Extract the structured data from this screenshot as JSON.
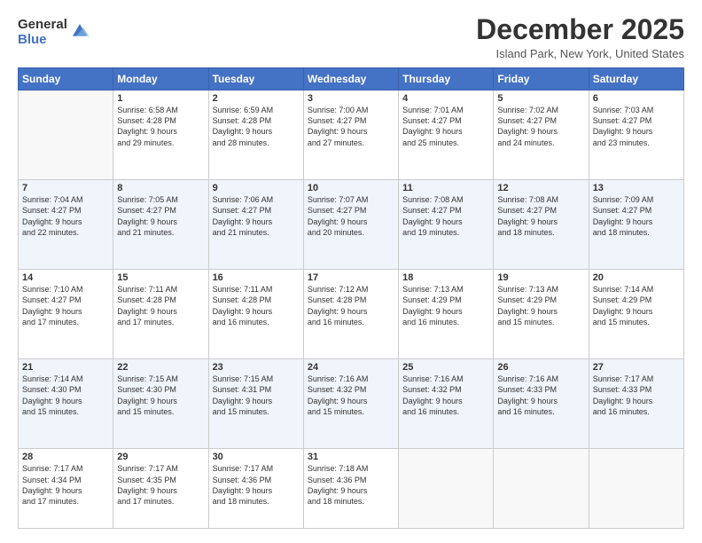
{
  "logo": {
    "general": "General",
    "blue": "Blue"
  },
  "header": {
    "month": "December 2025",
    "location": "Island Park, New York, United States"
  },
  "days_of_week": [
    "Sunday",
    "Monday",
    "Tuesday",
    "Wednesday",
    "Thursday",
    "Friday",
    "Saturday"
  ],
  "weeks": [
    [
      {
        "day": "",
        "info": ""
      },
      {
        "day": "1",
        "info": "Sunrise: 6:58 AM\nSunset: 4:28 PM\nDaylight: 9 hours\nand 29 minutes."
      },
      {
        "day": "2",
        "info": "Sunrise: 6:59 AM\nSunset: 4:28 PM\nDaylight: 9 hours\nand 28 minutes."
      },
      {
        "day": "3",
        "info": "Sunrise: 7:00 AM\nSunset: 4:27 PM\nDaylight: 9 hours\nand 27 minutes."
      },
      {
        "day": "4",
        "info": "Sunrise: 7:01 AM\nSunset: 4:27 PM\nDaylight: 9 hours\nand 25 minutes."
      },
      {
        "day": "5",
        "info": "Sunrise: 7:02 AM\nSunset: 4:27 PM\nDaylight: 9 hours\nand 24 minutes."
      },
      {
        "day": "6",
        "info": "Sunrise: 7:03 AM\nSunset: 4:27 PM\nDaylight: 9 hours\nand 23 minutes."
      }
    ],
    [
      {
        "day": "7",
        "info": "Sunrise: 7:04 AM\nSunset: 4:27 PM\nDaylight: 9 hours\nand 22 minutes."
      },
      {
        "day": "8",
        "info": "Sunrise: 7:05 AM\nSunset: 4:27 PM\nDaylight: 9 hours\nand 21 minutes."
      },
      {
        "day": "9",
        "info": "Sunrise: 7:06 AM\nSunset: 4:27 PM\nDaylight: 9 hours\nand 21 minutes."
      },
      {
        "day": "10",
        "info": "Sunrise: 7:07 AM\nSunset: 4:27 PM\nDaylight: 9 hours\nand 20 minutes."
      },
      {
        "day": "11",
        "info": "Sunrise: 7:08 AM\nSunset: 4:27 PM\nDaylight: 9 hours\nand 19 minutes."
      },
      {
        "day": "12",
        "info": "Sunrise: 7:08 AM\nSunset: 4:27 PM\nDaylight: 9 hours\nand 18 minutes."
      },
      {
        "day": "13",
        "info": "Sunrise: 7:09 AM\nSunset: 4:27 PM\nDaylight: 9 hours\nand 18 minutes."
      }
    ],
    [
      {
        "day": "14",
        "info": "Sunrise: 7:10 AM\nSunset: 4:27 PM\nDaylight: 9 hours\nand 17 minutes."
      },
      {
        "day": "15",
        "info": "Sunrise: 7:11 AM\nSunset: 4:28 PM\nDaylight: 9 hours\nand 17 minutes."
      },
      {
        "day": "16",
        "info": "Sunrise: 7:11 AM\nSunset: 4:28 PM\nDaylight: 9 hours\nand 16 minutes."
      },
      {
        "day": "17",
        "info": "Sunrise: 7:12 AM\nSunset: 4:28 PM\nDaylight: 9 hours\nand 16 minutes."
      },
      {
        "day": "18",
        "info": "Sunrise: 7:13 AM\nSunset: 4:29 PM\nDaylight: 9 hours\nand 16 minutes."
      },
      {
        "day": "19",
        "info": "Sunrise: 7:13 AM\nSunset: 4:29 PM\nDaylight: 9 hours\nand 15 minutes."
      },
      {
        "day": "20",
        "info": "Sunrise: 7:14 AM\nSunset: 4:29 PM\nDaylight: 9 hours\nand 15 minutes."
      }
    ],
    [
      {
        "day": "21",
        "info": "Sunrise: 7:14 AM\nSunset: 4:30 PM\nDaylight: 9 hours\nand 15 minutes."
      },
      {
        "day": "22",
        "info": "Sunrise: 7:15 AM\nSunset: 4:30 PM\nDaylight: 9 hours\nand 15 minutes."
      },
      {
        "day": "23",
        "info": "Sunrise: 7:15 AM\nSunset: 4:31 PM\nDaylight: 9 hours\nand 15 minutes."
      },
      {
        "day": "24",
        "info": "Sunrise: 7:16 AM\nSunset: 4:32 PM\nDaylight: 9 hours\nand 15 minutes."
      },
      {
        "day": "25",
        "info": "Sunrise: 7:16 AM\nSunset: 4:32 PM\nDaylight: 9 hours\nand 16 minutes."
      },
      {
        "day": "26",
        "info": "Sunrise: 7:16 AM\nSunset: 4:33 PM\nDaylight: 9 hours\nand 16 minutes."
      },
      {
        "day": "27",
        "info": "Sunrise: 7:17 AM\nSunset: 4:33 PM\nDaylight: 9 hours\nand 16 minutes."
      }
    ],
    [
      {
        "day": "28",
        "info": "Sunrise: 7:17 AM\nSunset: 4:34 PM\nDaylight: 9 hours\nand 17 minutes."
      },
      {
        "day": "29",
        "info": "Sunrise: 7:17 AM\nSunset: 4:35 PM\nDaylight: 9 hours\nand 17 minutes."
      },
      {
        "day": "30",
        "info": "Sunrise: 7:17 AM\nSunset: 4:36 PM\nDaylight: 9 hours\nand 18 minutes."
      },
      {
        "day": "31",
        "info": "Sunrise: 7:18 AM\nSunset: 4:36 PM\nDaylight: 9 hours\nand 18 minutes."
      },
      {
        "day": "",
        "info": ""
      },
      {
        "day": "",
        "info": ""
      },
      {
        "day": "",
        "info": ""
      }
    ]
  ]
}
